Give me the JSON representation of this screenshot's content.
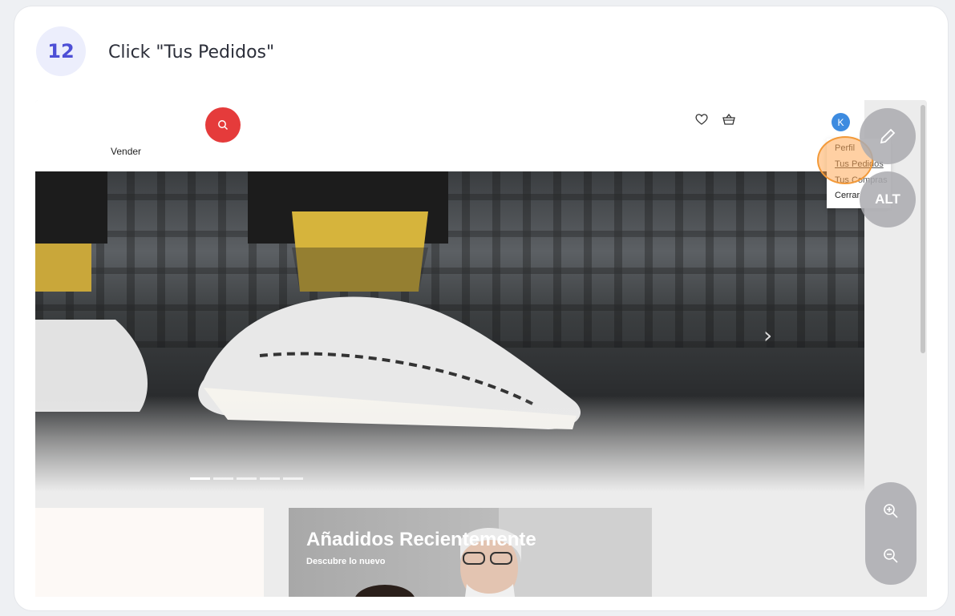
{
  "step": {
    "number": "12",
    "instruction": "Click \"Tus Pedidos\""
  },
  "site": {
    "sell_link": "Vender",
    "account_menu": {
      "avatar_letter": "K",
      "items": [
        "Perfil",
        "Tus Pedidos",
        "Tus Compras",
        "Cerrar"
      ]
    },
    "promo": {
      "title": "Añadidos Recientemente",
      "subtitle": "Descubre lo nuevo"
    }
  },
  "overlay": {
    "alt_label": "ALT"
  },
  "colors": {
    "accent": "#4d4fd6",
    "search": "#e53b3b",
    "avatar": "#3d8be0",
    "click": "#f39a3a"
  }
}
